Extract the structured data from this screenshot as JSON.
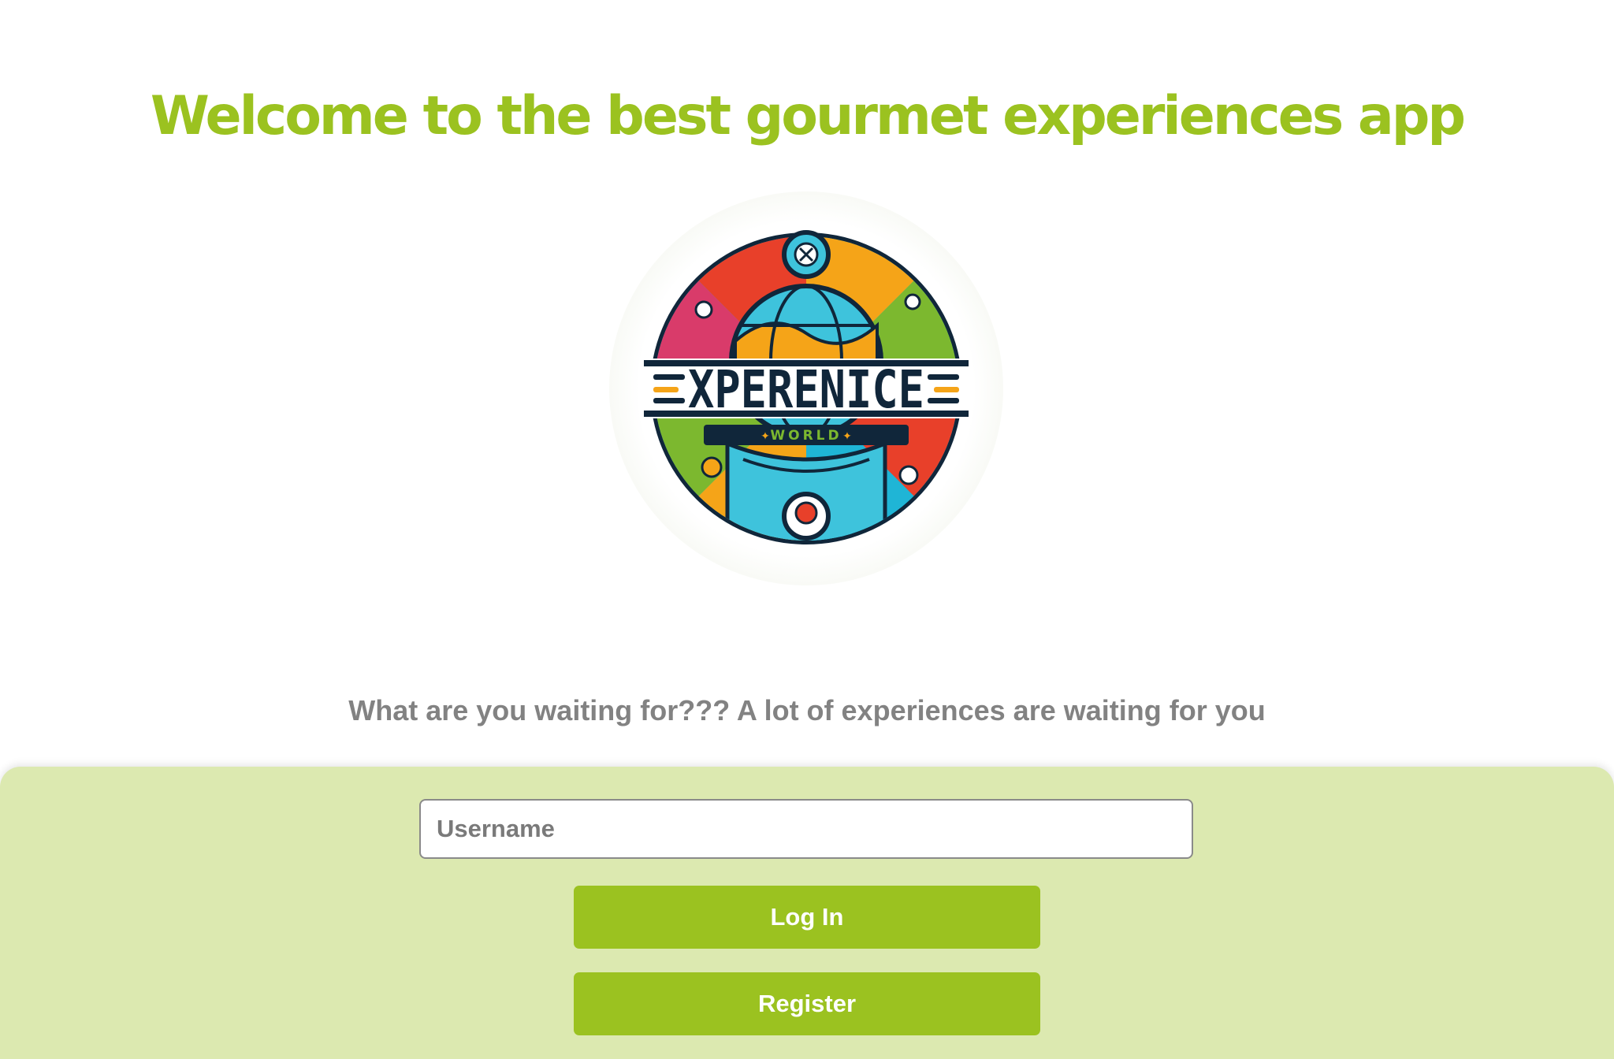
{
  "header": {
    "title": "Welcome to the best gourmet experiences app"
  },
  "logo": {
    "main_text": "XPERENICE",
    "sub_text": "WORLD"
  },
  "tagline": "What are you waiting for??? A lot of experiences are waiting for you",
  "login_form": {
    "username_placeholder": "Username",
    "username_value": "",
    "login_label": "Log In",
    "register_label": "Register"
  },
  "colors": {
    "accent": "#9bc220",
    "panel_bg": "#dce9b0",
    "tagline": "#828282"
  }
}
